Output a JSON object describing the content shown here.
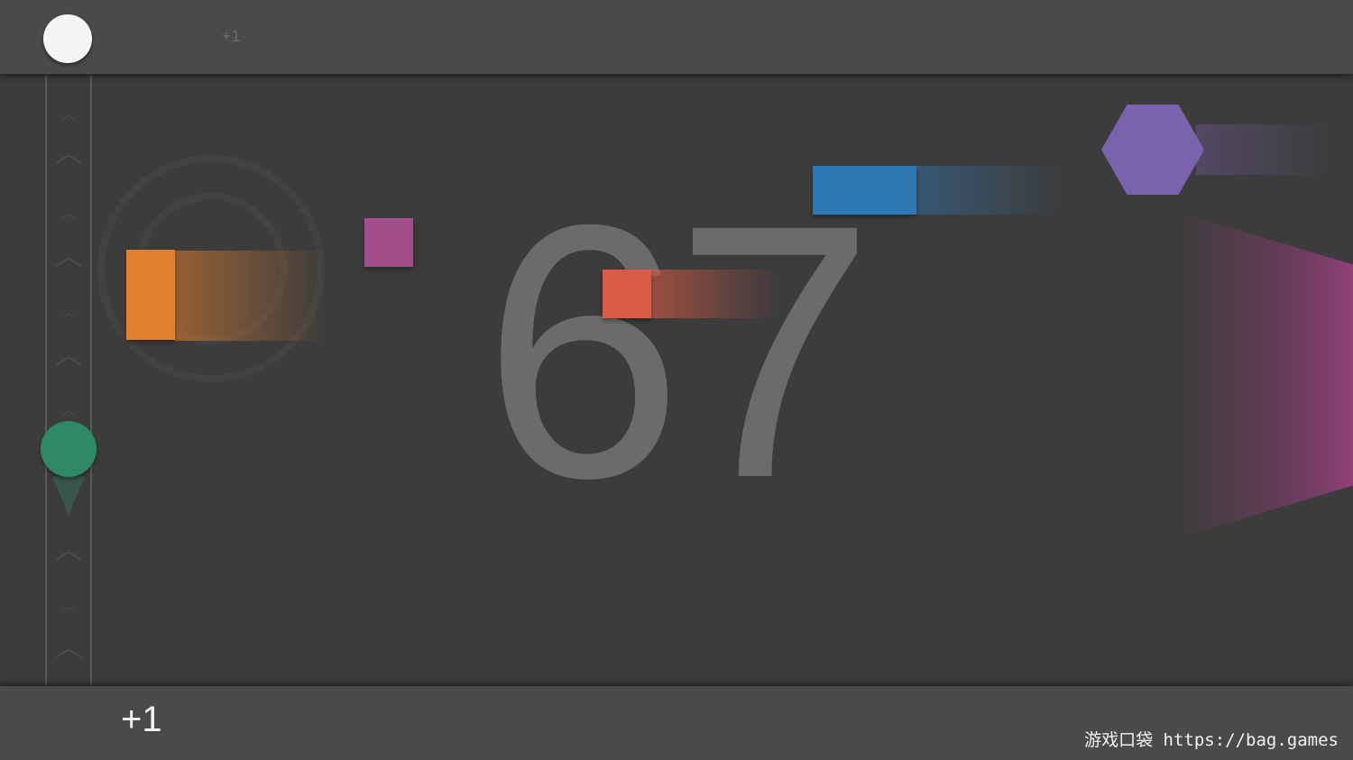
{
  "score": "67",
  "hud": {
    "top_bonus": "+1",
    "bottom_bonus": "+1",
    "watermark": "游戏口袋 https://bag.games"
  },
  "colors": {
    "background": "#3c3c3c",
    "bar": "#4a4a4a",
    "player": "#2e8a64",
    "lives_ball": "#f5f5f5",
    "orange_block": "#e07f2e",
    "magenta_block": "#a44d8b",
    "red_block": "#db5a43",
    "blue_block": "#2d79b5",
    "purple_hexagon": "#7a62ad",
    "magenta_beam": "#a0418a"
  },
  "icons": {
    "lives": "white-circle",
    "player": "green-circle",
    "track_arrows": "chevron-up"
  }
}
